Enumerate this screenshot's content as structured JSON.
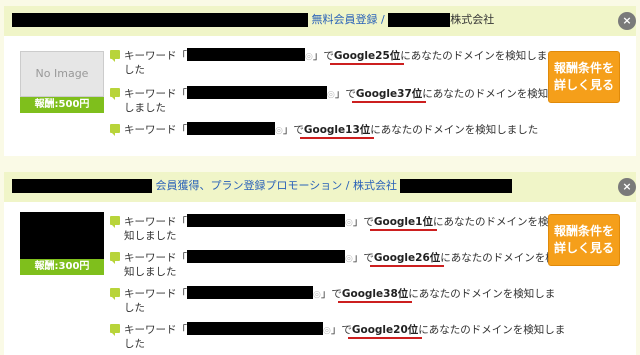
{
  "cards": [
    {
      "title_link": "無料会員登録 /",
      "title_suffix": "株式会社",
      "thumb_text": "No Image",
      "price": "報酬:500円",
      "button": [
        "報酬条件を",
        "詳しく見る"
      ],
      "rows": [
        {
          "prefix": "キーワード「",
          "close": "」で",
          "rank": "Google25位",
          "suffix": "にあなたのドメインを検知しま",
          "line2": "した"
        },
        {
          "prefix": "キーワード「",
          "close": "」で",
          "rank": "Google37位",
          "suffix": "にあなたのドメインを検知",
          "line2": "しました"
        },
        {
          "prefix": "キーワード「",
          "close": "」で",
          "rank": "Google13位",
          "suffix": "にあなたのドメインを検知しました",
          "line2": ""
        }
      ]
    },
    {
      "title_link": "会員獲得、プラン登録プロモーション / 株式会社",
      "title_suffix": "",
      "thumb_text": "",
      "price": "報酬:300円",
      "button": [
        "報酬条件を",
        "詳しく見る"
      ],
      "rows": [
        {
          "prefix": "キーワード「",
          "close": "」で",
          "rank": "Google1位",
          "suffix": "にあなたのドメインを検",
          "line2": "知しました"
        },
        {
          "prefix": "キーワード「",
          "close": "」で",
          "rank": "Google26位",
          "suffix": "にあなたのドメインを検",
          "line2": "知しました"
        },
        {
          "prefix": "キーワード「",
          "close": "」で",
          "rank": "Google38位",
          "suffix": "にあなたのドメインを検知しま",
          "line2": "した"
        },
        {
          "prefix": "キーワード「",
          "close": "」で",
          "rank": "Google20位",
          "suffix": "にあなたのドメインを検知しま",
          "line2": "した"
        }
      ]
    }
  ],
  "close_icon": "×",
  "colors": {
    "header": "#f0f5c8",
    "link": "#2a62b8",
    "price": "#7fbf1c",
    "button": "#f59f1a",
    "underline": "#cc1f1f"
  }
}
